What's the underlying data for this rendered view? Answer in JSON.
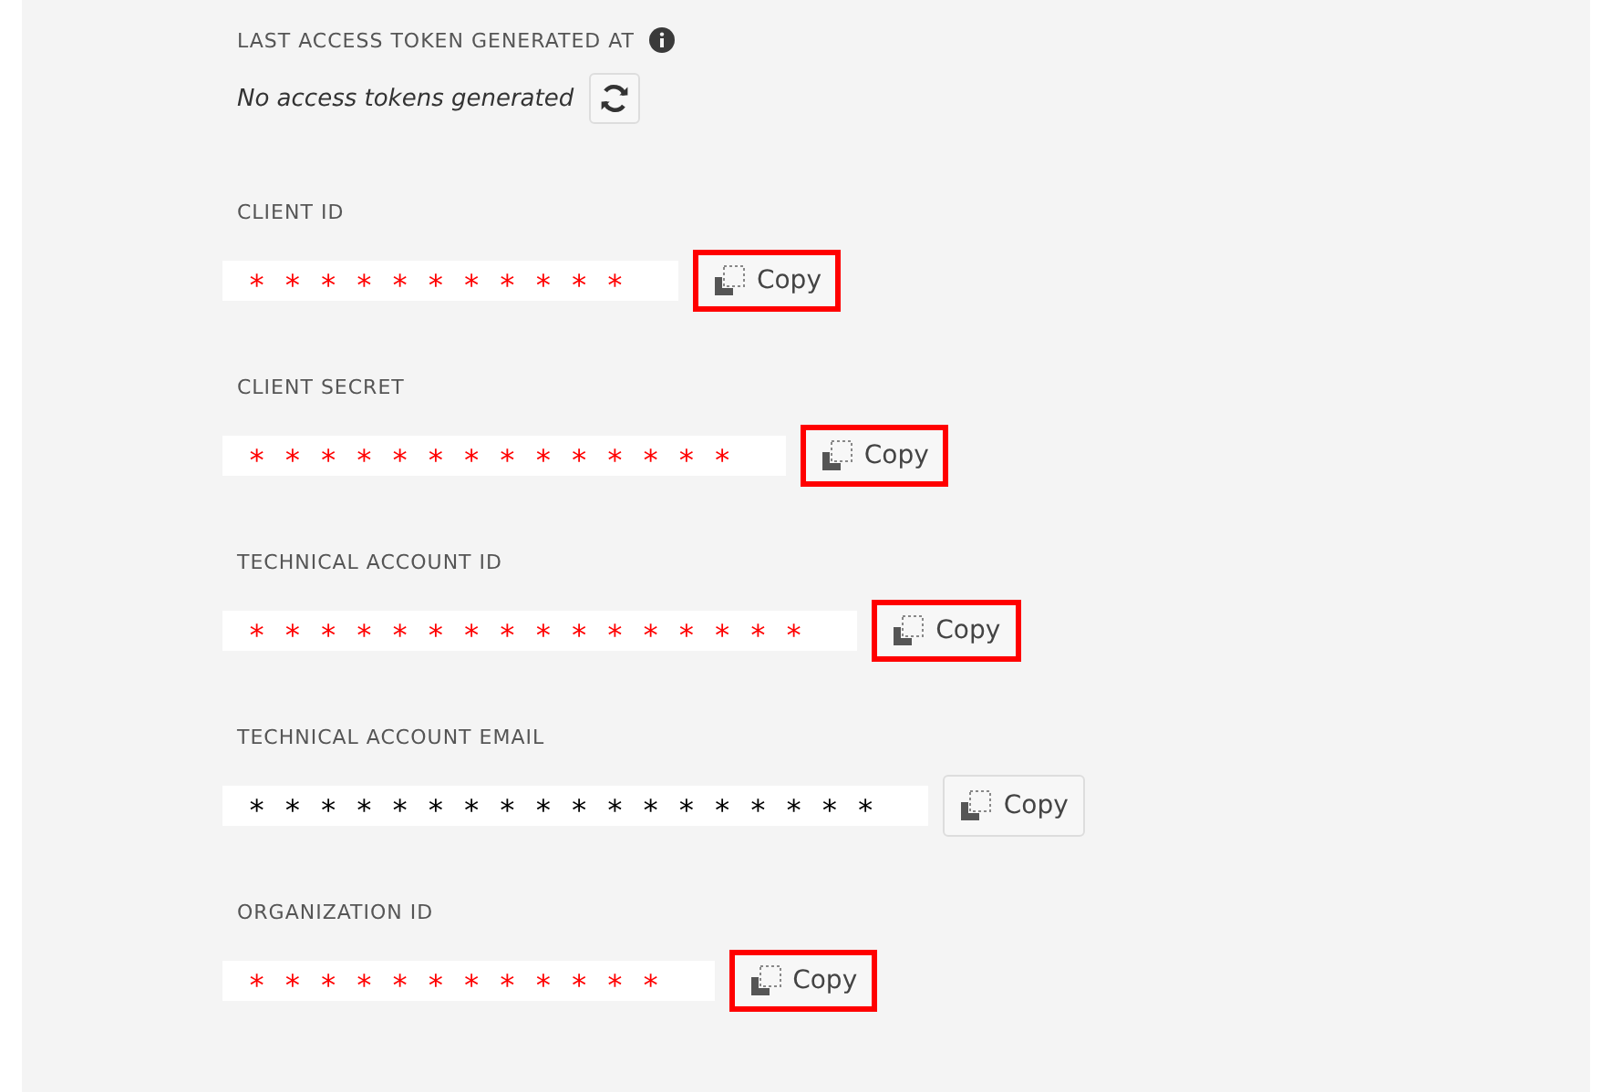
{
  "token": {
    "label": "LAST ACCESS TOKEN GENERATED AT",
    "status": "No access tokens generated"
  },
  "fields": [
    {
      "label": "CLIENT ID",
      "value": "***********",
      "color": "#ff0000",
      "copy": "Copy",
      "highlighted": true
    },
    {
      "label": "CLIENT SECRET",
      "value": "**************",
      "color": "#ff0000",
      "copy": "Copy",
      "highlighted": true
    },
    {
      "label": "TECHNICAL ACCOUNT ID",
      "value": "****************",
      "color": "#ff0000",
      "copy": "Copy",
      "highlighted": true
    },
    {
      "label": "TECHNICAL ACCOUNT EMAIL",
      "value": "******************",
      "color": "#000000",
      "copy": "Copy",
      "highlighted": false
    },
    {
      "label": "ORGANIZATION ID",
      "value": "************",
      "color": "#ff0000",
      "copy": "Copy",
      "highlighted": true
    }
  ]
}
